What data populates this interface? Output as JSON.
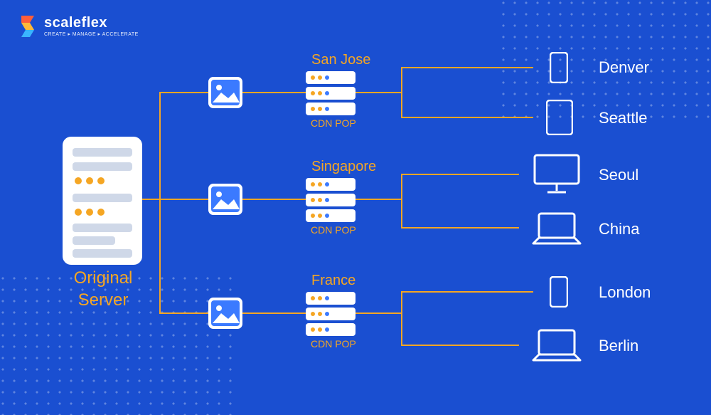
{
  "brand": {
    "name": "scaleflex",
    "tagline": "CREATE ▸ MANAGE ▸ ACCELERATE"
  },
  "origin": {
    "label_line1": "Original",
    "label_line2": "Server"
  },
  "pops": [
    {
      "title": "San Jose",
      "subtitle": "CDN POP"
    },
    {
      "title": "Singapore",
      "subtitle": "CDN POP"
    },
    {
      "title": "France",
      "subtitle": "CDN POP"
    }
  ],
  "devices": [
    {
      "name": "Denver",
      "type": "phone"
    },
    {
      "name": "Seattle",
      "type": "tablet"
    },
    {
      "name": "Seoul",
      "type": "desktop"
    },
    {
      "name": "China",
      "type": "laptop"
    },
    {
      "name": "London",
      "type": "phone"
    },
    {
      "name": "Berlin",
      "type": "laptop"
    }
  ],
  "colors": {
    "bg": "#1a4fd1",
    "accent": "#f5a623",
    "icon_blue": "#3b7aff"
  }
}
